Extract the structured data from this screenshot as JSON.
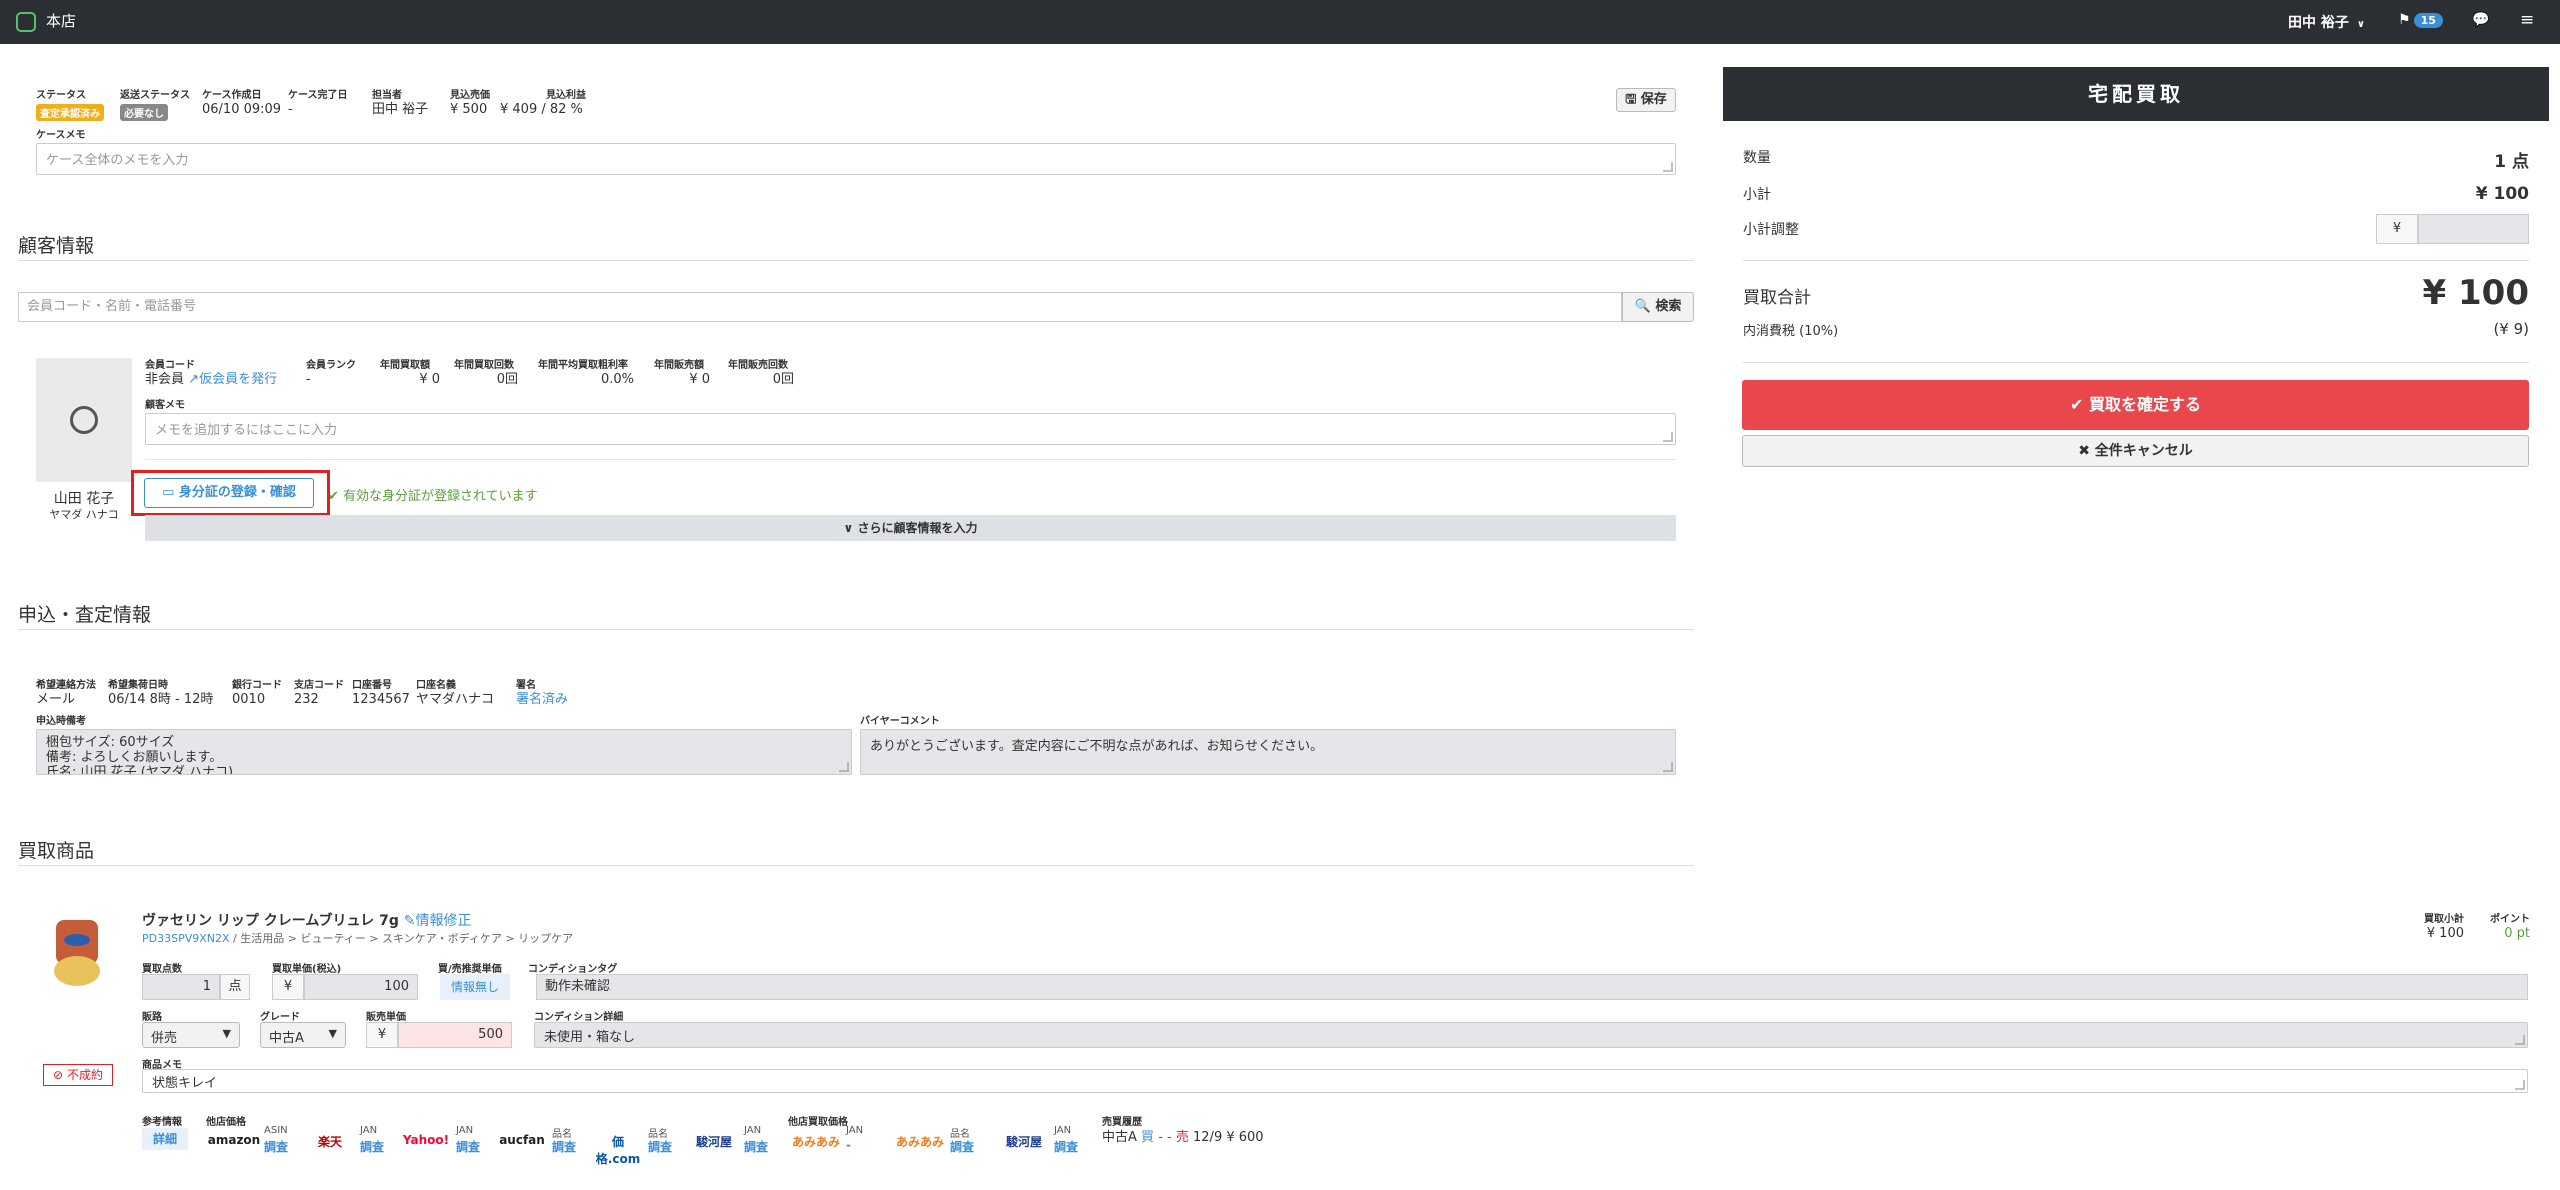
{
  "topbar": {
    "store": "本店",
    "user": "田中 裕子",
    "notifications": "15"
  },
  "case": {
    "status_label": "ステータス",
    "status_value": "査定承認済み",
    "return_status_label": "返送ステータス",
    "return_status_value": "必要なし",
    "created_label": "ケース作成日",
    "created_value": "06/10 09:09",
    "completed_label": "ケース完了日",
    "completed_value": "-",
    "assignee_label": "担当者",
    "assignee_value": "田中 裕子",
    "est_sales_label": "見込売価",
    "est_sales_value": "¥ 500",
    "est_profit_label": "見込利益",
    "est_profit_value": "¥ 409 / 82 %",
    "save": "保存",
    "memo_label": "ケースメモ",
    "memo_placeholder": "ケース全体のメモを入力"
  },
  "customer": {
    "title": "顧客情報",
    "search_placeholder": "会員コード・名前・電話番号",
    "search_button": "検索",
    "member_code_label": "会員コード",
    "member_code_value": "非会員",
    "issue_temp": "仮会員を発行",
    "rank_label": "会員ランク",
    "rank_value": "-",
    "annual_buy_label": "年間買取額",
    "annual_buy_value": "¥ 0",
    "annual_buy_count_label": "年間買取回数",
    "annual_buy_count_value": "0回",
    "avg_rate_label": "年間平均買取粗利率",
    "avg_rate_value": "0.0%",
    "annual_sales_label": "年間販売額",
    "annual_sales_value": "¥ 0",
    "annual_sales_count_label": "年間販売回数",
    "annual_sales_count_value": "0回",
    "memo_label": "顧客メモ",
    "memo_placeholder": "メモを追加するにはここに入力",
    "id_button": "身分証の登録・確認",
    "id_status": "有効な身分証が登録されています",
    "more_button": "さらに顧客情報を入力",
    "name": "山田 花子",
    "kana": "ヤマダ ハナコ"
  },
  "application": {
    "title": "申込・査定情報",
    "contact_label": "希望連絡方法",
    "contact_value": "メール",
    "pickup_label": "希望集荷日時",
    "pickup_value": "06/14 8時 - 12時",
    "bank_label": "銀行コード",
    "bank_value": "0010",
    "branch_label": "支店コード",
    "branch_value": "232",
    "account_label": "口座番号",
    "account_value": "1234567",
    "holder_label": "口座名義",
    "holder_value": "ヤマダハナコ",
    "sign_label": "署名",
    "sign_value": "署名済み",
    "notes_label": "申込時備考",
    "notes_line1": "梱包サイズ: 60サイズ",
    "notes_line2": "備考: よろしくお願いします。",
    "notes_line3": "氏名: 山田 花子 (ヤマダ ハナコ)",
    "buyer_comment_label": "バイヤーコメント",
    "buyer_comment_value": "ありがとうございます。査定内容にご不明な点があれば、お知らせください。"
  },
  "products": {
    "title": "買取商品",
    "name": "ヴァセリン リップ クレームブリュレ 7g",
    "edit": "情報修正",
    "code": "PD33SPV9XN2X",
    "category": "/ 生活用品 > ビューティー > スキンケア・ボディケア > リップケア",
    "subtotal_label": "買取小計",
    "subtotal_value": "¥ 100",
    "point_label": "ポイント",
    "point_value": "0 pt",
    "qty_label": "買取点数",
    "qty_value": "1",
    "qty_unit": "点",
    "price_label": "買取単価(税込)",
    "price_value": "100",
    "yen": "¥",
    "suggest_label": "買/売推奨単価",
    "suggest_value": "情報無し",
    "condition_tag_label": "コンディションタグ",
    "condition_tag_value": "動作未確認",
    "channel_label": "販路",
    "channel_value": "併売",
    "grade_label": "グレード",
    "grade_value": "中古A",
    "sale_label": "販売単価",
    "sale_value": "500",
    "condition_detail_label": "コンディション詳細",
    "condition_detail_value": "未使用・箱なし",
    "memo_label": "商品メモ",
    "memo_value": "状態キレイ",
    "failed": "不成約",
    "ref_label": "参考情報",
    "ref_button": "詳細",
    "other_price_label": "他店価格",
    "other_buy_label": "他店買取価格",
    "history_label": "売買履歴",
    "history_value_prefix": "中古A",
    "history_buy": "買",
    "history_dash": "- -",
    "history_sell": "売",
    "history_value_suffix": "12/9 ¥ 600",
    "stores": [
      {
        "logo": "amazon",
        "key": "ASIN",
        "action": "調査",
        "color": "#222"
      },
      {
        "logo": "楽天",
        "key": "JAN",
        "action": "調査",
        "color": "#bf0000"
      },
      {
        "logo": "Yahoo!",
        "key": "JAN",
        "action": "調査",
        "color": "#ff0033"
      },
      {
        "logo": "aucfan",
        "key": "品名",
        "action": "調査",
        "color": "#222"
      },
      {
        "logo": "価格.com",
        "key": "品名",
        "action": "調査",
        "color": "#0a57a4"
      },
      {
        "logo": "駿河屋",
        "key": "JAN",
        "action": "調査",
        "color": "#1f3f8f"
      }
    ],
    "buy_stores": [
      {
        "logo": "あみあみ",
        "key": "JAN",
        "action": "-",
        "color": "#f07a1c"
      },
      {
        "logo": "あみあみ",
        "key": "品名",
        "action": "調査",
        "color": "#f07a1c"
      },
      {
        "logo": "駿河屋",
        "key": "JAN",
        "action": "調査",
        "color": "#1f3f8f"
      }
    ]
  },
  "summary": {
    "title": "宅配買取",
    "qty_label": "数量",
    "qty_value": "1 点",
    "subtotal_label": "小計",
    "subtotal_value": "¥ 100",
    "adjust_label": "小計調整",
    "adjust_prefix": "¥",
    "total_label": "買取合計",
    "total_value": "¥ 100",
    "tax_label": "内消費税 (10%)",
    "tax_value": "(¥ 9)",
    "confirm": "買取を確定する",
    "cancel": "全件キャンセル"
  }
}
